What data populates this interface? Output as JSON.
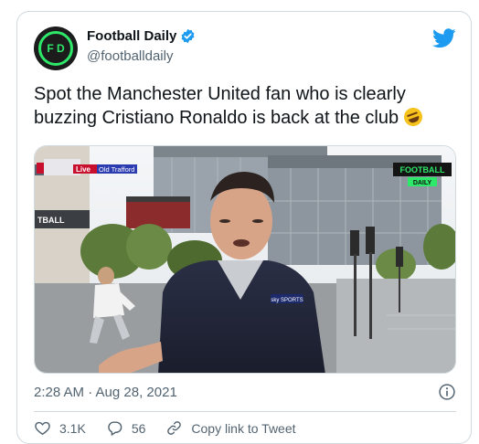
{
  "account": {
    "name": "Football Daily",
    "handle": "@footballdaily",
    "avatar_text": "F D"
  },
  "tweet": {
    "text": "Spot the Manchester United fan who is clearly buzzing Cristiano Ronaldo is back at the club",
    "emoji": "rolling-on-floor-laughing"
  },
  "media": {
    "live_badge": "Live",
    "location": "Old Trafford",
    "channel_line1": "FOOTBALL",
    "channel_line2": "DAILY",
    "mic_logo": "sky SPORTS",
    "sign_text": "TBALL"
  },
  "meta": {
    "timestamp": "2:28 AM · Aug 28, 2021"
  },
  "actions": {
    "likes": "3.1K",
    "replies": "56",
    "copy_link": "Copy link to Tweet"
  },
  "colors": {
    "twitter_blue": "#1d9bf0",
    "brand_green": "#2ee86a",
    "text_secondary": "#536471"
  }
}
